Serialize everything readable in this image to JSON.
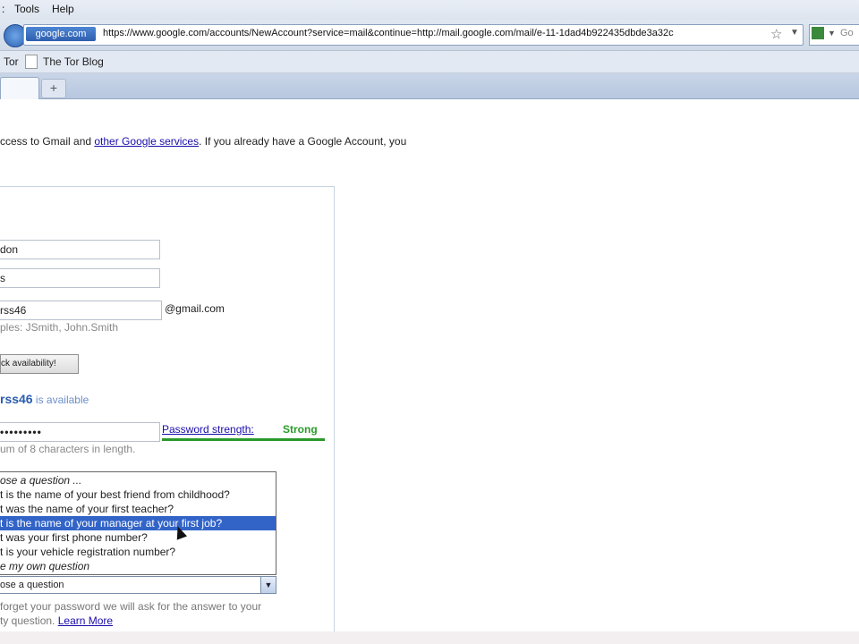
{
  "menubar": {
    "items": [
      ":",
      "Tools",
      "Help"
    ]
  },
  "addressbar": {
    "site_identity": "google.com",
    "url": "https://www.google.com/accounts/NewAccount?service=mail&continue=http://mail.google.com/mail/e-11-1dad4b922435dbde3a32c",
    "search_engine": "Go"
  },
  "bookmarks": {
    "items": [
      "Tor",
      "The Tor Blog"
    ]
  },
  "tabs": {
    "new_tab": "+"
  },
  "intro": {
    "text_before": "ccess to Gmail and ",
    "link": "other Google services",
    "text_after": ". If you already have a Google Account, you"
  },
  "form": {
    "first_name": "don",
    "last_name": "s",
    "login_name": "rss46",
    "domain_suffix": "@gmail.com",
    "login_hint": "ples: JSmith, John.Smith",
    "check_availability": "ck availability!",
    "availability_user": "rss46",
    "availability_text": " is available",
    "password_value": "•••••••••",
    "password_hint": "um of 8 characters in length.",
    "password_strength_label": "Password strength:",
    "password_strength_value": "Strong",
    "security_question": {
      "options": [
        "ose a question ...",
        "t is the name of your best friend from childhood?",
        "t was the name of your first teacher?",
        "t is the name of your manager at your first job?",
        "t was your first phone number?",
        "t is your vehicle registration number?",
        "e my own question"
      ],
      "selected_index": 3,
      "select_value": "ose a question",
      "help_text": "forget your password we will ask for the answer to your",
      "help_text2": "ty question. ",
      "learn_more": "Learn More"
    }
  }
}
